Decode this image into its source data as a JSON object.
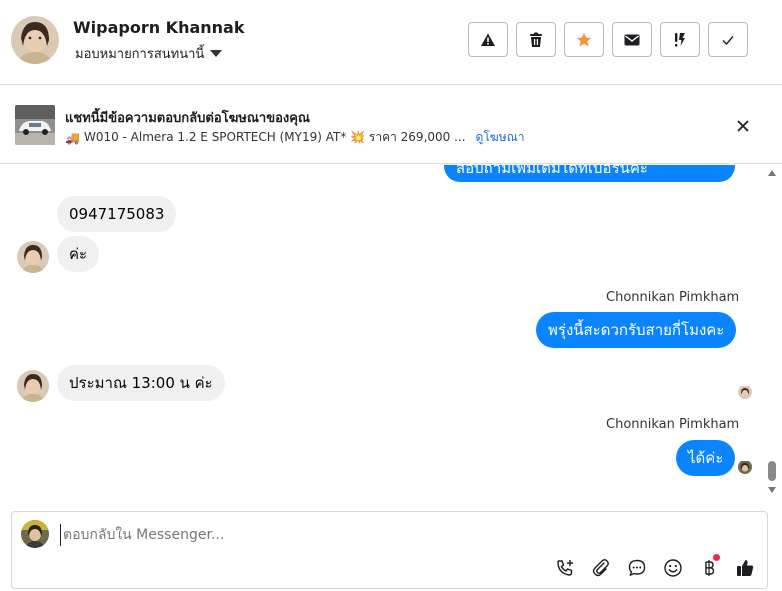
{
  "header": {
    "contact_name": "Wipaporn Khannak",
    "assign_label": "มอบหมายการสนทนานี้",
    "actions": [
      {
        "name": "report-button",
        "icon": "warning-icon"
      },
      {
        "name": "delete-button",
        "icon": "trash-icon"
      },
      {
        "name": "star-button",
        "icon": "star-icon"
      },
      {
        "name": "mark-unread-button",
        "icon": "envelope-icon"
      },
      {
        "name": "follow-up-button",
        "icon": "exclamation-icon"
      },
      {
        "name": "mark-done-button",
        "icon": "check-icon"
      }
    ]
  },
  "ad": {
    "title": "แชทนี้มีข้อความตอบกลับต่อโฆษณาของคุณ",
    "description": "W010 - Almera 1.2 E SPORTECH (MY19) AT* 💥 ราคา 269,000 ...",
    "link_label": "ดูโฆษณา"
  },
  "messages": {
    "partial_out": "สอบถามเพิ่มเติมได้ที่เบอร์นี้ค่ะ",
    "m1": "0947175083",
    "m2": "ค่ะ",
    "sender1": "Chonnikan Pimkham",
    "m3": "พรุ่งนี้สะดวกรับสายกี่โมงคะ",
    "m4": "ประมาณ 13:00 น ค่ะ",
    "sender2": "Chonnikan Pimkham",
    "m5": "ได้ค่ะ"
  },
  "composer": {
    "placeholder": "ตอบกลับใน Messenger...",
    "tools": [
      "call-add-icon",
      "paperclip-icon",
      "saved-reply-icon",
      "emoji-icon",
      "baht-icon",
      "thumbs-up-icon"
    ]
  },
  "colors": {
    "outgoing_bubble": "#0b84ff",
    "incoming_bubble": "#f0f0f0",
    "star": "#f7923a",
    "link": "#1a6ed8",
    "badge": "#f02849"
  }
}
